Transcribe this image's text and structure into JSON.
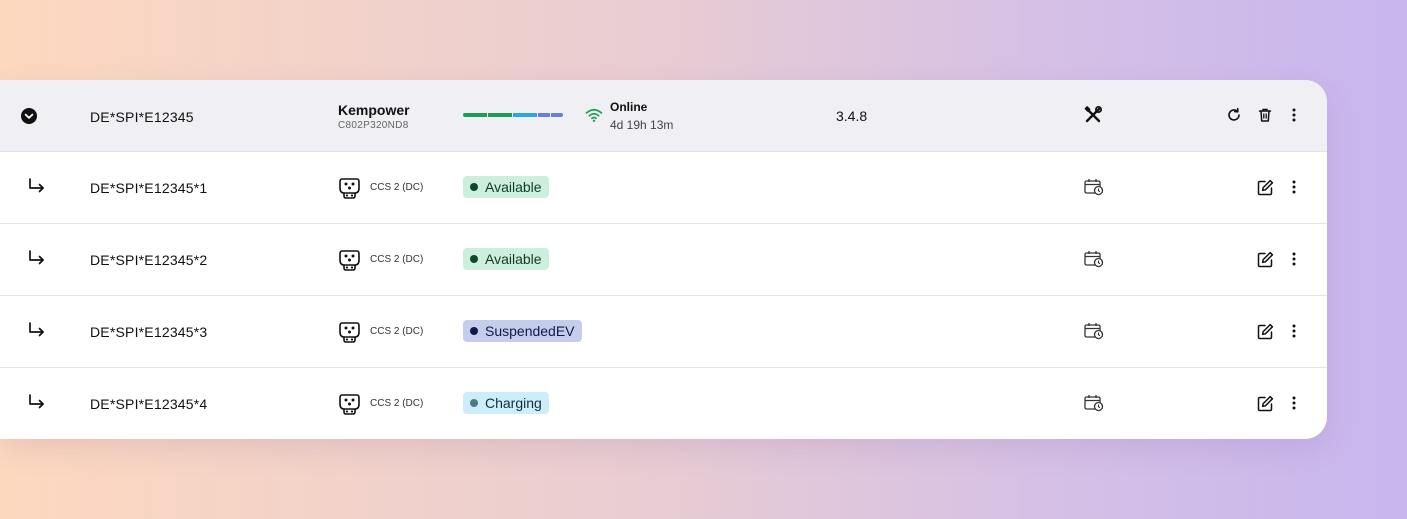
{
  "station": {
    "id": "DE*SPI*E12345",
    "vendor": "Kempower",
    "serial": "C802P320ND8",
    "status": "Online",
    "uptime": "4d 19h 13m",
    "firmware": "3.4.8",
    "connector_summary": [
      {
        "color": "#1f9d55"
      },
      {
        "color": "#1f9d55"
      },
      {
        "color": "#2aa6df"
      },
      {
        "color": "#6a7fd1"
      },
      {
        "color": "#6a7fd1"
      }
    ]
  },
  "connectors": [
    {
      "id": "DE*SPI*E12345*1",
      "type": "CCS 2 (DC)",
      "status": "Available",
      "badge_bg": "#cdeedd",
      "badge_fg": "#0f3d24",
      "dot": "#0d4a2a"
    },
    {
      "id": "DE*SPI*E12345*2",
      "type": "CCS 2 (DC)",
      "status": "Available",
      "badge_bg": "#cdeedd",
      "badge_fg": "#0f3d24",
      "dot": "#0d4a2a"
    },
    {
      "id": "DE*SPI*E12345*3",
      "type": "CCS 2 (DC)",
      "status": "SuspendedEV",
      "badge_bg": "#c6cdec",
      "badge_fg": "#101a4a",
      "dot": "#0e1a4f"
    },
    {
      "id": "DE*SPI*E12345*4",
      "type": "CCS 2 (DC)",
      "status": "Charging",
      "badge_bg": "#cdeef8",
      "badge_fg": "#0f2f3d",
      "dot": "#4d7a88"
    }
  ]
}
